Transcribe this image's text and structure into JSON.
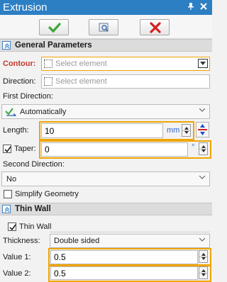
{
  "window": {
    "title": "Extrusion"
  },
  "toolbar": {
    "ok_icon": "check-icon",
    "preview_icon": "preview-icon",
    "cancel_icon": "close-icon"
  },
  "sections": {
    "general": {
      "title": "General Parameters",
      "contour_label": "Contour:",
      "contour_placeholder": "Select element",
      "direction_label": "Direction:",
      "direction_placeholder": "Select element",
      "first_direction_label": "First Direction:",
      "first_direction_value": "Automatically",
      "length_label": "Length:",
      "length_value": "10",
      "length_unit": "mm",
      "taper_label": "Taper:",
      "taper_value": "0",
      "taper_unit": "°",
      "second_direction_label": "Second Direction:",
      "second_direction_value": "No",
      "simplify_label": "Simplify Geometry"
    },
    "thinwall": {
      "title": "Thin Wall",
      "enable_label": "Thin Wall",
      "thickness_label": "Thickness:",
      "thickness_value": "Double sided",
      "value1_label": "Value 1:",
      "value1": "0.5",
      "value2_label": "Value 2:",
      "value2": "0.5"
    }
  },
  "colors": {
    "title_bar": "#2d7fc4",
    "highlight": "#f0a500",
    "ok": "#3aa83a",
    "cancel": "#d42020"
  }
}
